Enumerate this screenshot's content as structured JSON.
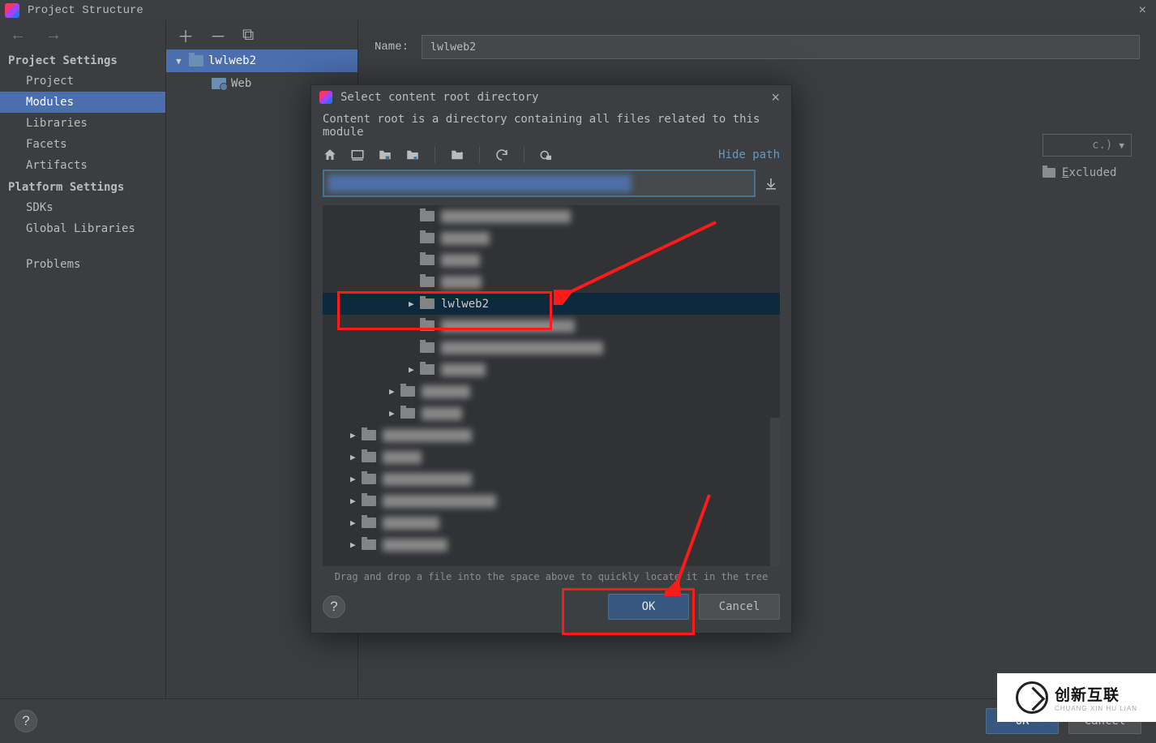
{
  "window": {
    "title": "Project Structure"
  },
  "sidebar": {
    "sections": [
      {
        "title": "Project Settings",
        "items": [
          "Project",
          "Modules",
          "Libraries",
          "Facets",
          "Artifacts"
        ],
        "active": 1
      },
      {
        "title": "Platform Settings",
        "items": [
          "SDKs",
          "Global Libraries"
        ]
      },
      {
        "title": "",
        "items": [
          "Problems"
        ]
      }
    ]
  },
  "modules": {
    "root": "lwlweb2",
    "child": "Web"
  },
  "main": {
    "name_label": "Name:",
    "name_value": "lwlweb2",
    "combo_suffix": "c.)",
    "excluded_label": "Excluded"
  },
  "bottom": {
    "ok": "OK",
    "cancel": "Cancel"
  },
  "dialog": {
    "title": "Select content root directory",
    "desc": "Content root is a directory containing all files related to this module",
    "hide_path": "Hide path",
    "drag_hint": "Drag and drop a file into the space above to quickly locate it in the tree",
    "ok": "OK",
    "cancel": "Cancel",
    "selected_folder": "lwlweb2",
    "rows": [
      {
        "indent": 106,
        "arrow": false,
        "blurW": 160
      },
      {
        "indent": 106,
        "arrow": false,
        "blurW": 60
      },
      {
        "indent": 106,
        "arrow": false,
        "blurW": 48
      },
      {
        "indent": 106,
        "arrow": false,
        "blurW": 50
      },
      {
        "indent": 106,
        "arrow": true,
        "label": "lwlweb2",
        "selected": true
      },
      {
        "indent": 106,
        "arrow": false,
        "blurW": 165
      },
      {
        "indent": 106,
        "arrow": false,
        "blurW": 200
      },
      {
        "indent": 106,
        "arrow": true,
        "blurW": 55
      },
      {
        "indent": 82,
        "arrow": true,
        "blurW": 60
      },
      {
        "indent": 82,
        "arrow": true,
        "blurW": 50
      },
      {
        "indent": 34,
        "arrow": true,
        "blurW": 110
      },
      {
        "indent": 34,
        "arrow": true,
        "blurW": 48
      },
      {
        "indent": 34,
        "arrow": true,
        "blurW": 110
      },
      {
        "indent": 34,
        "arrow": true,
        "blurW": 140
      },
      {
        "indent": 34,
        "arrow": true,
        "blurW": 70
      },
      {
        "indent": 34,
        "arrow": true,
        "blurW": 80
      }
    ]
  },
  "watermark": {
    "big": "创新互联",
    "small": "CHUANG XIN HU LIAN"
  }
}
